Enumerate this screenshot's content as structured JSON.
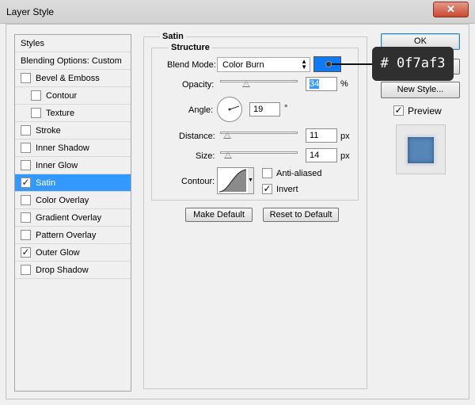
{
  "window": {
    "title": "Layer Style",
    "close_glyph": "✕"
  },
  "style_list": {
    "header": "Styles",
    "blending": "Blending Options: Custom",
    "items": [
      {
        "label": "Bevel & Emboss",
        "checked": false
      },
      {
        "label": "Contour",
        "checked": false
      },
      {
        "label": "Texture",
        "checked": false
      },
      {
        "label": "Stroke",
        "checked": false
      },
      {
        "label": "Inner Shadow",
        "checked": false
      },
      {
        "label": "Inner Glow",
        "checked": false
      },
      {
        "label": "Satin",
        "checked": true
      },
      {
        "label": "Color Overlay",
        "checked": false
      },
      {
        "label": "Gradient Overlay",
        "checked": false
      },
      {
        "label": "Pattern Overlay",
        "checked": false
      },
      {
        "label": "Outer Glow",
        "checked": true
      },
      {
        "label": "Drop Shadow",
        "checked": false
      }
    ],
    "check_glyph": "✓"
  },
  "satin": {
    "group_title": "Satin",
    "structure_title": "Structure",
    "blend_mode_label": "Blend Mode:",
    "blend_mode_value": "Color Burn",
    "color": "#0f7af3",
    "opacity_label": "Opacity:",
    "opacity_value": "34",
    "opacity_unit": "%",
    "angle_label": "Angle:",
    "angle_value": "19",
    "angle_unit": "°",
    "distance_label": "Distance:",
    "distance_value": "11",
    "distance_unit": "px",
    "size_label": "Size:",
    "size_value": "14",
    "size_unit": "px",
    "contour_label": "Contour:",
    "antialiased_label": "Anti-aliased",
    "antialiased_checked": false,
    "invert_label": "Invert",
    "invert_checked": true,
    "make_default": "Make Default",
    "reset_default": "Reset to Default"
  },
  "actions": {
    "ok": "OK",
    "new_style": "New Style...",
    "preview_label": "Preview",
    "preview_checked": true
  },
  "callout": {
    "text": "# 0f7af3"
  },
  "colors": {
    "selection": "#3399ff",
    "satin_color": "#0f7af3",
    "close_button": "#c84a31"
  }
}
